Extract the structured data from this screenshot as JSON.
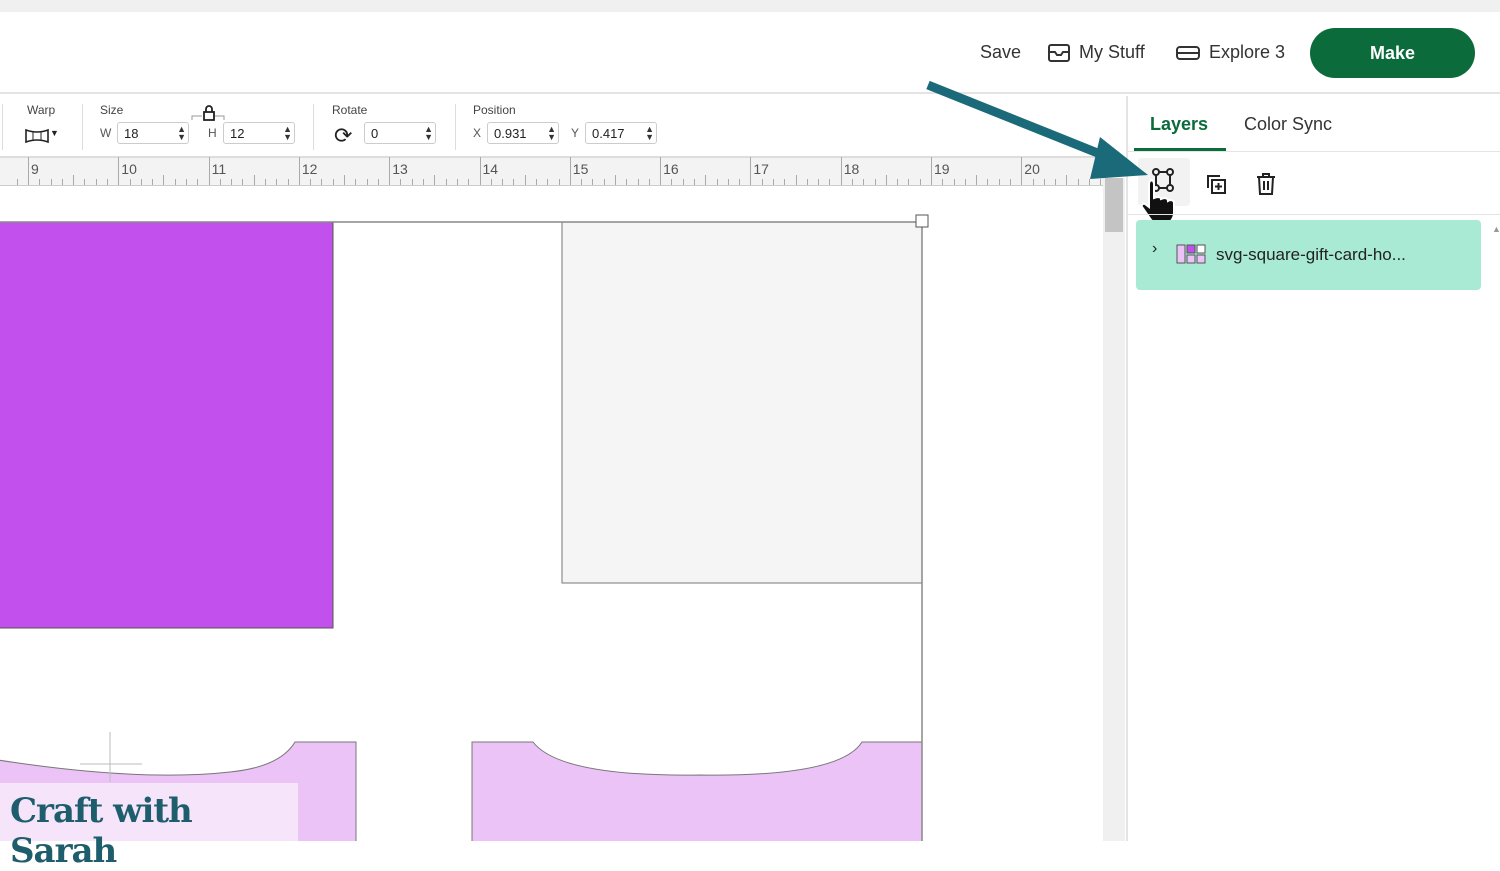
{
  "header": {
    "save": "Save",
    "my_stuff": "My Stuff",
    "machine": "Explore 3",
    "make": "Make"
  },
  "toolbar": {
    "warp_label": "Warp",
    "size_label": "Size",
    "w_label": "W",
    "w_value": "18",
    "h_label": "H",
    "h_value": "12",
    "rotate_label": "Rotate",
    "rotate_value": "0",
    "position_label": "Position",
    "x_label": "X",
    "x_value": "0.931",
    "y_label": "Y",
    "y_value": "0.417"
  },
  "ruler": {
    "numbers": [
      "9",
      "10",
      "11",
      "12",
      "13",
      "14",
      "15",
      "16",
      "17",
      "18",
      "19",
      "20"
    ]
  },
  "panel": {
    "tabs": [
      "Layers",
      "Color Sync"
    ],
    "active_tab": "Layers",
    "layer_name": "svg-square-gift-card-ho..."
  },
  "watermark": "Craft with Sarah",
  "colors": {
    "accent": "#0b6b3a",
    "purple": "#c150ec",
    "light_purple": "#ebc3f7",
    "layer_bg": "#a8ead4",
    "arrow": "#1b6a7a"
  }
}
